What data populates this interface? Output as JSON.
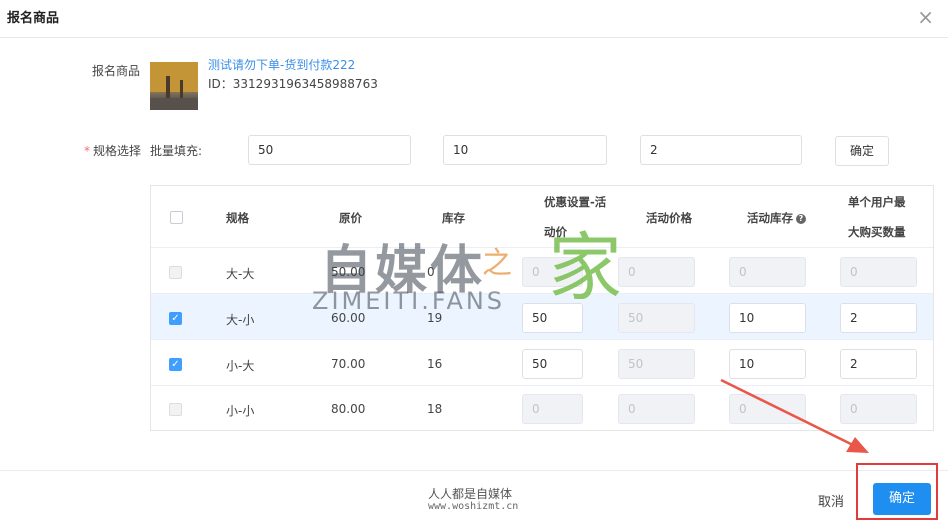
{
  "dialog": {
    "title": "报名商品",
    "close_glyph": "×"
  },
  "product": {
    "label": "报名商品",
    "name": "测试请勿下单-货到付款222",
    "id_text": "ID：3312931963458988763"
  },
  "spec": {
    "required_mark": "*",
    "label": "规格选择",
    "bulk_label": "批量填充:",
    "bulk_values": [
      "50",
      "10",
      "2"
    ],
    "confirm_label": "确定"
  },
  "table": {
    "headers": {
      "spec": "规格",
      "price": "原价",
      "stock": "库存",
      "discount_line1": "优惠设置-活",
      "discount_line2": "动价",
      "activity_price": "活动价格",
      "activity_stock": "活动库存",
      "limit_line1": "单个用户最",
      "limit_line2": "大购买数量"
    },
    "rows": [
      {
        "spec": "大-大",
        "price": "50.00",
        "stock": "0",
        "checked": false,
        "disabled": true,
        "discount": "0",
        "activity_price": "0",
        "activity_stock": "0",
        "limit": "0"
      },
      {
        "spec": "大-小",
        "price": "60.00",
        "stock": "19",
        "checked": true,
        "disabled": false,
        "discount": "50",
        "activity_price": "50",
        "activity_stock": "10",
        "limit": "2"
      },
      {
        "spec": "小-大",
        "price": "70.00",
        "stock": "16",
        "checked": true,
        "disabled": false,
        "discount": "50",
        "activity_price": "50",
        "activity_stock": "10",
        "limit": "2"
      },
      {
        "spec": "小-小",
        "price": "80.00",
        "stock": "18",
        "checked": false,
        "disabled": false,
        "discount": "0",
        "activity_price": "0",
        "activity_stock": "0",
        "limit": "0"
      }
    ]
  },
  "watermark": {
    "text_cn": "自媒体",
    "text_latin": "ZIMEITI.FANS",
    "text_zhi": "之",
    "text_jia": "家"
  },
  "footer": {
    "brand_cn": "人人都是自媒体",
    "brand_url": "www.woshizmt.cn",
    "cancel_label": "取消",
    "ok_label": "确定"
  },
  "icons": {
    "help": "question-icon",
    "close": "close-icon"
  },
  "colors": {
    "primary": "#1e8ef0",
    "highlight": "#e23b3b"
  }
}
